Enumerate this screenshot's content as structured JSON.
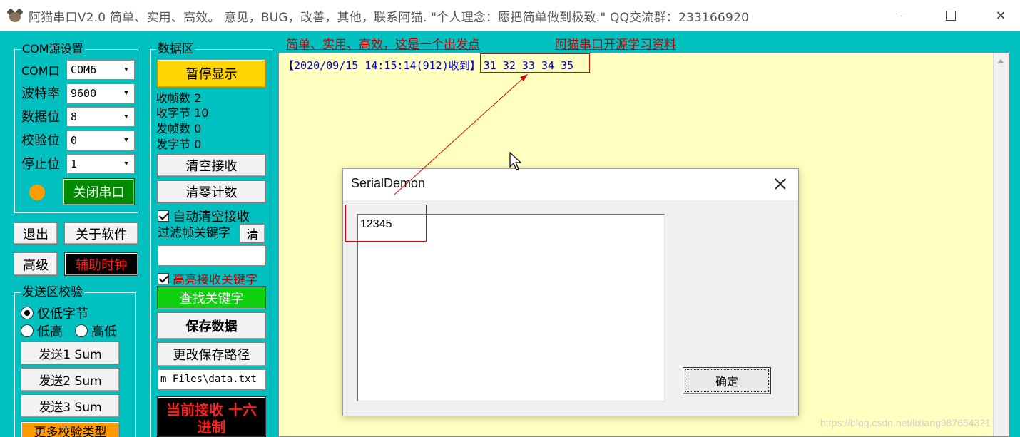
{
  "titlebar": {
    "title": "阿猫串口V2.0  简单、实用、高效。  意见，BUG，改善，其他，联系阿猫. \"个人理念：愿把简单做到极致.\"  QQ交流群：233166920"
  },
  "com_settings": {
    "group_title": "COM源设置",
    "port_label": "COM口",
    "port_value": "COM6",
    "baud_label": "波特率",
    "baud_value": "9600",
    "databits_label": "数据位",
    "databits_value": "8",
    "parity_label": "校验位",
    "parity_value": "0",
    "stopbits_label": "停止位",
    "stopbits_value": "1",
    "led_color": "#ff9d00",
    "close_port_label": "关闭串口"
  },
  "buttons": {
    "exit": "退出",
    "about": "关于软件",
    "advanced": "高级",
    "aux_clock": "辅助时钟"
  },
  "send_check": {
    "group_title": "发送区校验",
    "opt_low_only": "仅低字节",
    "opt_low_high": "低高",
    "opt_high_low": "高低",
    "send1": "发送1 Sum",
    "send2": "发送2 Sum",
    "send3": "发送3 Sum",
    "more": "更多校验类型"
  },
  "data_area": {
    "group_title": "数据区",
    "pause_display": "暂停显示",
    "recv_frames": "收帧数 2",
    "recv_bytes": "收字节 10",
    "send_frames": "发帧数 0",
    "send_bytes": "发字节 0",
    "clear_recv": "清空接收",
    "reset_count": "清零计数",
    "auto_clear": "自动清空接收",
    "filter_label": "过滤帧关键字",
    "filter_clear": "清",
    "filter_value": "",
    "highlight": "高亮接收关键字",
    "find_keyword": "查找关键字",
    "save_data": "保存数据",
    "change_path": "更改保存路径",
    "path_value": "m Files\\data.txt",
    "current_recv": "当前接收 十六进制"
  },
  "links": {
    "slogan": "简单、实用、高效，这是一个出发点",
    "open_source": "阿猫串口开源学习资料"
  },
  "receive": {
    "line_prefix": "【2020/09/15 14:15:14(912)收到】",
    "line_data": "31 32 33 34 35"
  },
  "dialog": {
    "title": "SerialDemon",
    "text_value": "12345",
    "ok_label": "确定"
  },
  "watermark": "https://blog.csdn.net/lixiang987654321",
  "colors": {
    "main_bg": "#00c0c0",
    "recv_bg": "#ffffc0",
    "recv_text": "#0000d0",
    "annotation_red": "#e00000",
    "link_red": "#c00000"
  }
}
